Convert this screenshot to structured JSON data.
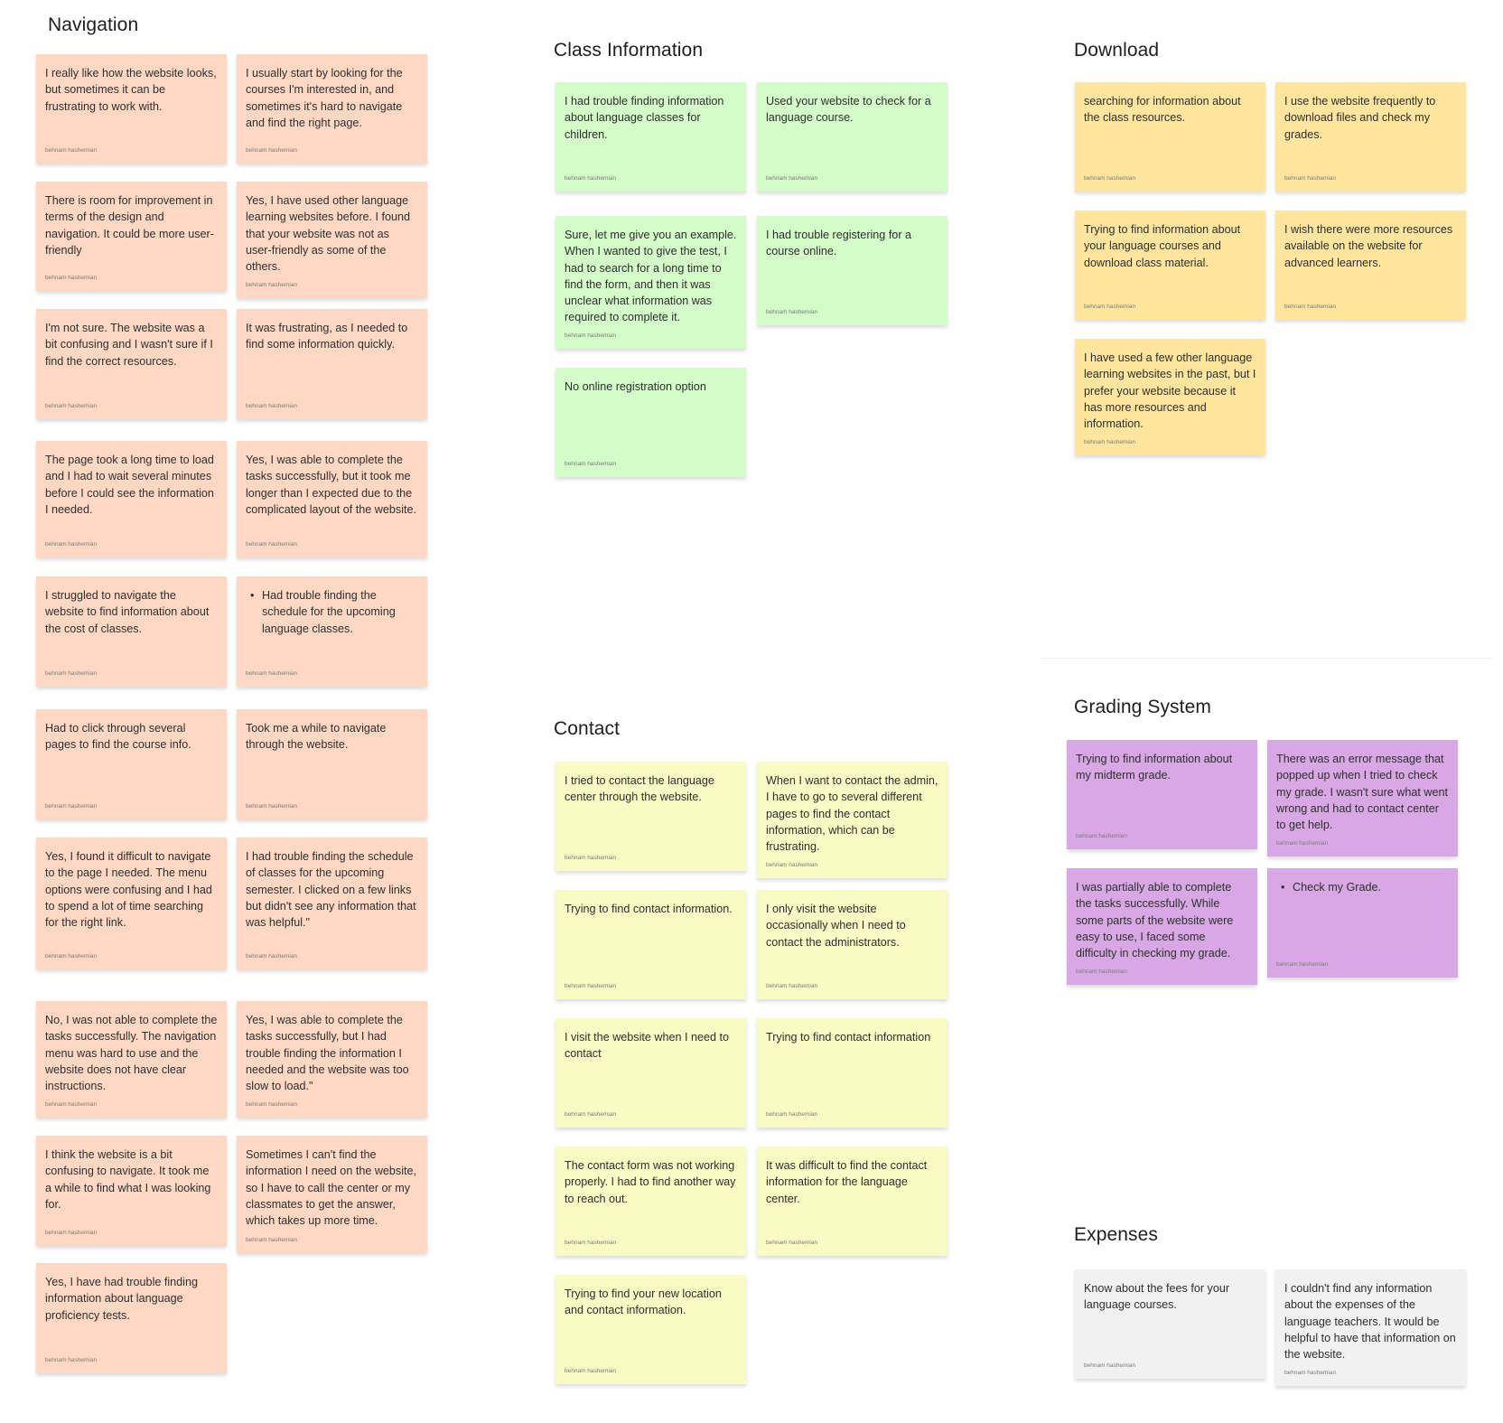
{
  "author": "behnam hashemian",
  "colors": {
    "navigation": "#FFD8C4",
    "class_information": "#D3FCC8",
    "contact": "#F8FCC4",
    "download": "#FFE59E",
    "grading": "#D8A8E4",
    "expenses": "#F1F1F1"
  },
  "sections": {
    "navigation": {
      "title": "Navigation",
      "cards": [
        {
          "text": "I really like how the website looks, but sometimes it can be frustrating to work with."
        },
        {
          "text": "I usually start by looking for the courses I'm interested in, and sometimes it's hard to navigate and find the right page."
        },
        {
          "text": "There is room for improvement in terms of the design and navigation. It could be more user-friendly"
        },
        {
          "text": "Yes, I have used other language learning websites before. I found that your website was not as user-friendly as some of the others."
        },
        {
          "text": "I'm not sure. The website was a bit confusing and I wasn't sure if I find the correct resources."
        },
        {
          "text": "It was frustrating, as I needed to find some information quickly."
        },
        {
          "text": "The page took a long time to load and I had to wait several minutes before I could see the information I needed."
        },
        {
          "text": "Yes, I was able to complete the tasks successfully, but it took me longer than I expected due to the complicated layout of the website."
        },
        {
          "text": "I struggled to navigate the website to find information about the cost of classes."
        },
        {
          "text": "Had trouble finding the schedule for the upcoming language classes.",
          "bullet": true
        },
        {
          "text": "Had to click through several pages to find the course info."
        },
        {
          "text": "Took me a while to navigate through the website."
        },
        {
          "text": "Yes, I found it difficult to navigate to the page I needed. The menu options were confusing and I had to spend a lot of time searching for the right link."
        },
        {
          "text": "I had trouble finding the schedule of classes for the upcoming semester. I clicked on a few links but didn't see any information that was helpful.\""
        },
        {
          "text": "No, I was not able to complete the tasks successfully. The navigation menu was hard  to use and the website does not have clear instructions."
        },
        {
          "text": "Yes, I was able to complete the tasks successfully, but I had trouble finding the information I needed and the website was too slow to load.\""
        },
        {
          "text": "I think the website is a bit confusing to navigate. It took me a while to find what I was looking for."
        },
        {
          "text": "Sometimes I can't find the information I need on the website, so I have to call the center or my classmates to get the answer, which takes up more time."
        },
        {
          "text": "Yes, I have had trouble finding information about language proficiency tests."
        }
      ]
    },
    "class_information": {
      "title": "Class Information",
      "cards": [
        {
          "text": "I had trouble finding information about language classes for children."
        },
        {
          "text": "Used your website to check for a language course."
        },
        {
          "text": "Sure, let me give you an example. When I wanted to give the test, I had to search for a long time to find the form, and then it was unclear what information was required to complete it."
        },
        {
          "text": "I had trouble registering for a course online."
        },
        {
          "text": "No online registration option"
        }
      ]
    },
    "contact": {
      "title": "Contact",
      "cards": [
        {
          "text": "I tried to contact the language center through the website."
        },
        {
          "text": "When I want to contact the admin, I have to go to several different pages to find the contact information, which can be frustrating."
        },
        {
          "text": "Trying to find contact information."
        },
        {
          "text": "I only visit the website occasionally when I need to contact the administrators."
        },
        {
          "text": "I visit the website when I need to contact"
        },
        {
          "text": "Trying to find contact information"
        },
        {
          "text": "The contact form was not working properly. I had to find another way to reach out."
        },
        {
          "text": "It was difficult to find the contact information for the language center."
        },
        {
          "text": "Trying to find your new location and contact information."
        }
      ]
    },
    "download": {
      "title": "Download",
      "cards": [
        {
          "text": "searching for information about the class resources."
        },
        {
          "text": "I use the website frequently to download files and check my grades."
        },
        {
          "text": "Trying to find information about your language courses and download class material."
        },
        {
          "text": "I wish there were more resources available on the website for advanced learners."
        },
        {
          "text": "I have used a few other language learning websites in the past, but I prefer your website because it has more resources and information."
        }
      ]
    },
    "grading": {
      "title": "Grading System",
      "cards": [
        {
          "text": "Trying to find information about my midterm grade."
        },
        {
          "text": "There was an error message that popped up when I tried to check my grade. I wasn't sure what went wrong and had to contact center to get help."
        },
        {
          "text": "I was partially able to complete the tasks successfully. While some parts of the website were easy to use, I faced some difficulty in checking my grade."
        },
        {
          "text": "Check my Grade.",
          "bullet": true
        }
      ]
    },
    "expenses": {
      "title": "Expenses",
      "cards": [
        {
          "text": "Know about the fees for your language courses."
        },
        {
          "text": "I couldn't find any information about the expenses of the language teachers. It would be helpful to have that information on the website."
        }
      ]
    }
  }
}
